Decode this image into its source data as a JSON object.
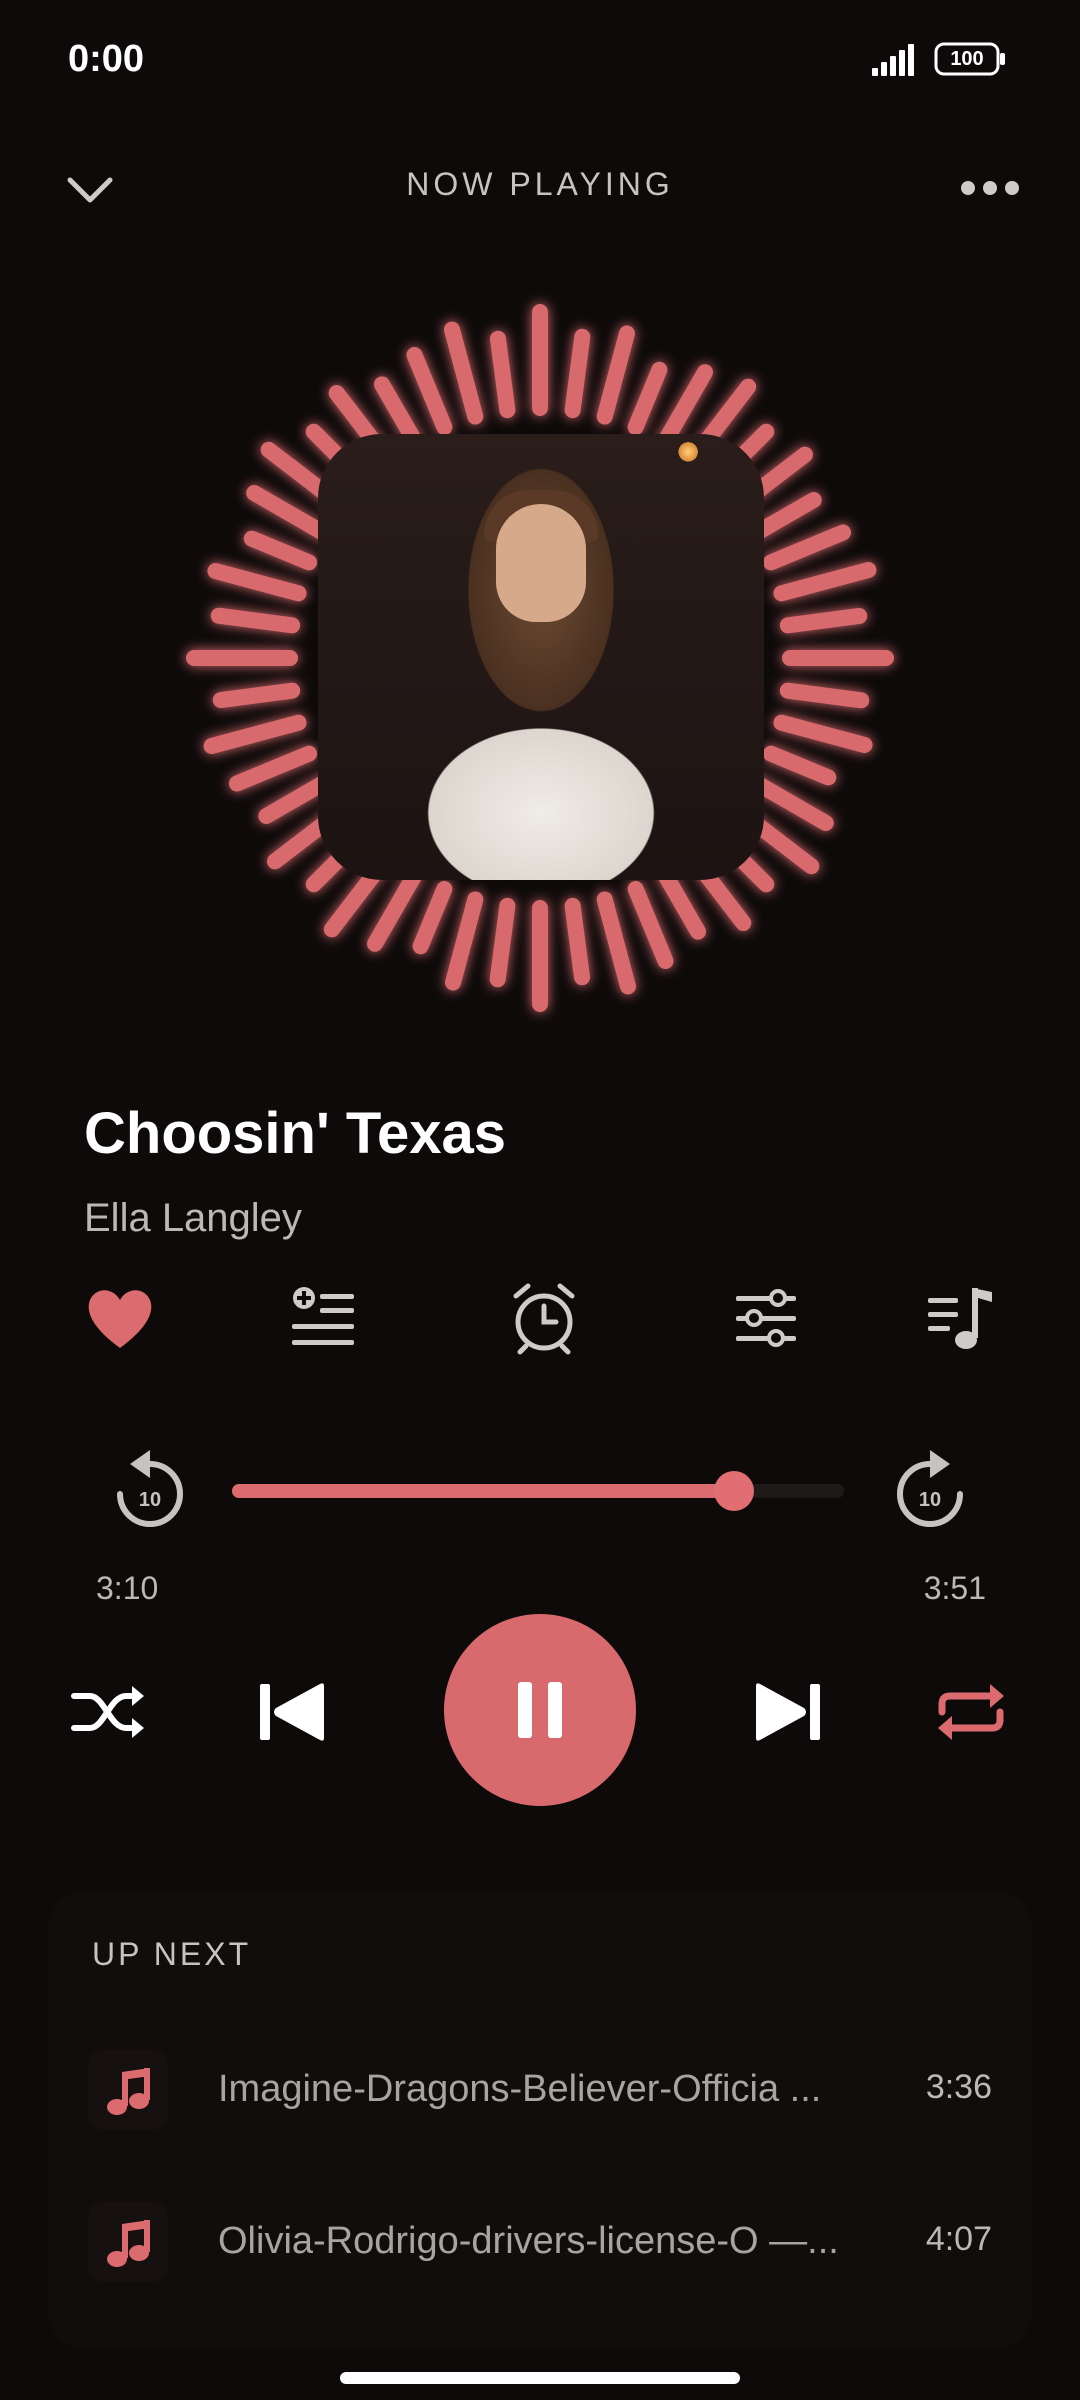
{
  "status_bar": {
    "time": "0:00",
    "battery": "100"
  },
  "header": {
    "title": "NOW PLAYING"
  },
  "track": {
    "title": "Choosin' Texas",
    "artist": "Ella Langley"
  },
  "progress": {
    "elapsed": "3:10",
    "total": "3:51",
    "fraction": 0.82,
    "skip_back_label": "10",
    "skip_forward_label": "10"
  },
  "upnext": {
    "title": "UP NEXT",
    "items": [
      {
        "name": "Imagine-Dragons-Believer-Officia ...",
        "duration": "3:36"
      },
      {
        "name": "Olivia-Rodrigo-drivers-license-O —...",
        "duration": "4:07"
      }
    ]
  },
  "colors": {
    "accent": "#d86a6e",
    "background": "#0e0a0a",
    "muted_text": "#bdb7b7"
  },
  "icons": {
    "collapse": "chevron-down-icon",
    "more": "more-dots-icon",
    "favorite": "heart-icon",
    "add_to_queue": "add-to-queue-icon",
    "sleep_timer": "alarm-clock-icon",
    "equalizer": "equalizer-icon",
    "playlist": "playlist-music-icon",
    "shuffle": "shuffle-icon",
    "previous": "skip-previous-icon",
    "pause": "pause-icon",
    "next": "skip-next-icon",
    "repeat": "repeat-icon",
    "queue_track": "music-note-icon"
  }
}
